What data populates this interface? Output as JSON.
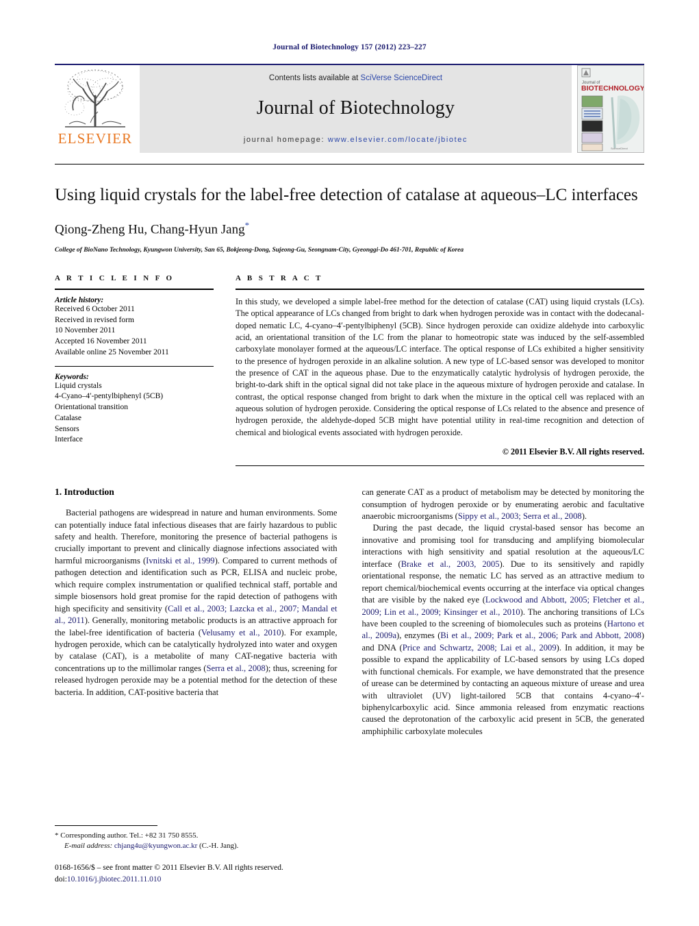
{
  "running_head": "Journal of Biotechnology 157 (2012) 223–227",
  "masthead": {
    "publisher_name": "ELSEVIER",
    "contents_prefix": "Contents lists available at ",
    "contents_link": "SciVerse ScienceDirect",
    "journal_name": "Journal of Biotechnology",
    "homepage_prefix": "journal homepage: ",
    "homepage_url": "www.elsevier.com/locate/jbiotec",
    "cover_title_small": "Journal of",
    "cover_title_main": "BIOTECHNOLOGY",
    "link_color": "#2b46a8",
    "elsevier_orange": "#E87722"
  },
  "article": {
    "title": "Using liquid crystals for the label-free detection of catalase at aqueous–LC interfaces",
    "authors": "Qiong-Zheng Hu, Chang-Hyun Jang",
    "corresponding_marker": "*",
    "affiliation": "College of BioNano Technology, Kyungwon University, San 65, Bokjeong-Dong, Sujeong-Gu, Seongnam-City, Gyeonggi-Do 461-701, Republic of Korea"
  },
  "article_info": {
    "heading": "A R T I C L E    I N F O",
    "history_label": "Article history:",
    "history_lines": [
      "Received 6 October 2011",
      "Received in revised form",
      "10 November 2011",
      "Accepted 16 November 2011",
      "Available online 25 November 2011"
    ],
    "keywords_label": "Keywords:",
    "keywords": [
      "Liquid crystals",
      "4-Cyano–4′-pentylbiphenyl (5CB)",
      "Orientational transition",
      "Catalase",
      "Sensors",
      "Interface"
    ]
  },
  "abstract": {
    "heading": "A B S T R A C T",
    "text": "In this study, we developed a simple label-free method for the detection of catalase (CAT) using liquid crystals (LCs). The optical appearance of LCs changed from bright to dark when hydrogen peroxide was in contact with the dodecanal-doped nematic LC, 4-cyano–4′-pentylbiphenyl (5CB). Since hydrogen peroxide can oxidize aldehyde into carboxylic acid, an orientational transition of the LC from the planar to homeotropic state was induced by the self-assembled carboxylate monolayer formed at the aqueous/LC interface. The optical response of LCs exhibited a higher sensitivity to the presence of hydrogen peroxide in an alkaline solution. A new type of LC-based sensor was developed to monitor the presence of CAT in the aqueous phase. Due to the enzymatically catalytic hydrolysis of hydrogen peroxide, the bright-to-dark shift in the optical signal did not take place in the aqueous mixture of hydrogen peroxide and catalase. In contrast, the optical response changed from bright to dark when the mixture in the optical cell was replaced with an aqueous solution of hydrogen peroxide. Considering the optical response of LCs related to the absence and presence of hydrogen peroxide, the aldehyde-doped 5CB might have potential utility in real-time recognition and detection of chemical and biological events associated with hydrogen peroxide.",
    "copyright": "© 2011 Elsevier B.V. All rights reserved."
  },
  "body": {
    "section_number_title": "1.  Introduction",
    "left_paragraph_1": {
      "t1": "Bacterial pathogens are widespread in nature and human environments. Some can potentially induce fatal infectious diseases that are fairly hazardous to public safety and health. Therefore, monitoring the presence of bacterial pathogens is crucially important to prevent and clinically diagnose infections associated with harmful microorganisms (",
      "r1": "Ivnitski et al., 1999",
      "t2": "). Compared to current methods of pathogen detection and identification such as PCR, ELISA and nucleic probe, which require complex instrumentation or qualified technical staff, portable and simple biosensors hold great promise for the rapid detection of pathogens with high specificity and sensitivity (",
      "r2": "Call et al., 2003; Lazcka et al., 2007; Mandal et al., 2011",
      "t3": "). Generally, monitoring metabolic products is an attractive approach for the label-free identification of bacteria (",
      "r3": "Velusamy et al., 2010",
      "t4": "). For example, hydrogen peroxide, which can be catalytically hydrolyzed into water and oxygen by catalase (CAT), is a metabolite of many CAT-negative bacteria with concentrations up to the millimolar ranges (",
      "r4": "Serra et al., 2008",
      "t5": "); thus, screening for released hydrogen peroxide may be a potential method for the detection of these bacteria. In addition, CAT-positive bacteria that"
    },
    "right_paragraph_1": {
      "t1": "can generate CAT as a product of metabolism may be detected by monitoring the consumption of hydrogen peroxide or by enumerating aerobic and facultative anaerobic microorganisms (",
      "r1": "Sippy et al., 2003; Serra et al., 2008",
      "t2": ")."
    },
    "right_paragraph_2": {
      "t1": "During the past decade, the liquid crystal-based sensor has become an innovative and promising tool for transducing and amplifying biomolecular interactions with high sensitivity and spatial resolution at the aqueous/LC interface (",
      "r1": "Brake et al., 2003, 2005",
      "t2": "). Due to its sensitively and rapidly orientational response, the nematic LC has served as an attractive medium to report chemical/biochemical events occurring at the interface via optical changes that are visible by the naked eye (",
      "r2": "Lockwood and Abbott, 2005; Fletcher et al., 2009; Lin et al., 2009; Kinsinger et al., 2010",
      "t3": "). The anchoring transitions of LCs have been coupled to the screening of biomolecules such as proteins (",
      "r3": "Hartono et al., 2009a",
      "t4": "), enzymes (",
      "r4": "Bi et al., 2009; Park et al., 2006; Park and Abbott, 2008",
      "t5": ") and DNA (",
      "r5": "Price and Schwartz, 2008; Lai et al., 2009",
      "t6": "). In addition, it may be possible to expand the applicability of LC-based sensors by using LCs doped with functional chemicals. For example, we have demonstrated that the presence of urease can be determined by contacting an aqueous mixture of urease and urea with ultraviolet (UV) light-tailored 5CB that contains 4-cyano–4′-biphenylcarboxylic acid. Since ammonia released from enzymatic reactions caused the deprotonation of the carboxylic acid present in 5CB, the generated amphiphilic carboxylate molecules"
    }
  },
  "footnotes": {
    "corresponding_marker": "*",
    "corresponding_text": "Corresponding author. Tel.: +82 31 750 8555.",
    "email_label": "E-mail address:",
    "email": "chjang4u@kyungwon.ac.kr",
    "email_suffix": "(C.-H. Jang).",
    "issn_line": "0168-1656/$ – see front matter © 2011 Elsevier B.V. All rights reserved.",
    "doi_prefix": "doi:",
    "doi_value": "10.1016/j.jbiotec.2011.11.010"
  }
}
